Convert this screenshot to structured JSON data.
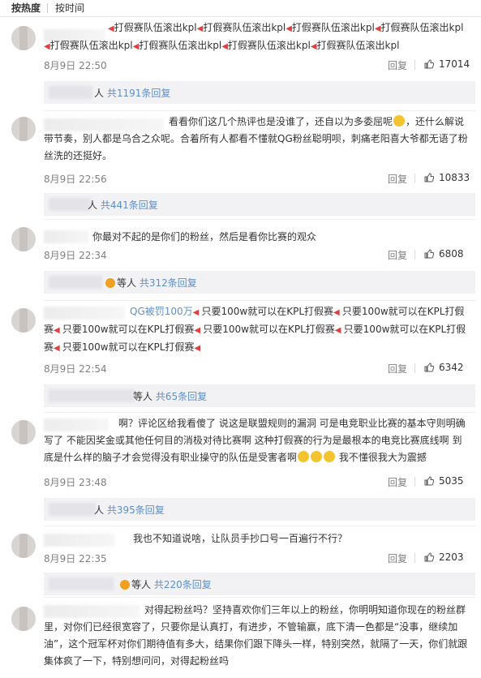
{
  "tabs": {
    "hot": "按热度",
    "time": "按时间"
  },
  "comments": [
    {
      "text_html": "<span class='speaker'>🔈</span>打假赛队伍滚出kpl<span class='speaker'>🔈</span>打假赛队伍滚出kpl<span class='speaker'>🔈</span>打假赛队伍滚出kpl<span class='speaker'>🔈</span>打假赛队伍滚出kpl<span class='speaker'>🔈</span>打假赛队伍滚出kpl<span class='speaker'>🔈</span>打假赛队伍滚出kpl<span class='speaker'>🔈</span>打假赛队伍滚出kpl<span class='speaker'>🔈</span>打假赛队伍滚出kpl",
      "date": "8月9日 22:50",
      "reply": "回复",
      "likes": "17014",
      "sub_prefix": "人 ",
      "sub_count": "共1191条回复"
    },
    {
      "text": "看看你们这几个热评也是没谁了，还自以为多委屈呢",
      "text2": "，还什么解说带节奏，别人都是乌合之众呢。合着所有人都看不懂就QG粉丝聪明呗，刺痛老阳喜大爷都无语了粉丝洗的还挺好。",
      "date": "8月9日 22:56",
      "reply": "回复",
      "likes": "10833",
      "sub_prefix": "人 ",
      "sub_count": "共441条回复"
    },
    {
      "text": "你最对不起的是你们的粉丝，然后是看你比赛的观众",
      "date": "8月9日 22:34",
      "reply": "回复",
      "likes": "6808",
      "sub_prefix": "等人 ",
      "sub_count": "共312条回复"
    },
    {
      "text_lead": "QG被罚100万",
      "text": "只要100w就可以在KPL打假赛",
      "text_tail": "只要100w就可以在KPL打假赛",
      "date": "8月9日 22:54",
      "reply": "回复",
      "likes": "6342",
      "sub_prefix": "等人 ",
      "sub_count": "共65条回复"
    },
    {
      "text": "啊？评论区给我看傻了 说这是联盟规则的漏洞 可是电竞职业比赛的基本守则明确写了 不能因奖金或其他任何目的消极对待比赛啊 这种打假赛的行为是最根本的电竞比赛底线啊 到底是什么样的脑子才会觉得没有职业操守的队伍是受害者啊",
      "text_tail": "我不懂很我大为震撼",
      "date": "8月9日 23:48",
      "reply": "回复",
      "likes": "5035",
      "sub_prefix": "人 ",
      "sub_count": "共395条回复"
    },
    {
      "text": "我也不知道说啥，让队员手抄口号一百遍行不行？",
      "date": "8月9日 22:35",
      "reply": "回复",
      "likes": "2203",
      "sub_prefix": "等人 ",
      "sub_count": "共220条回复"
    },
    {
      "text": "对得起粉丝吗？坚持喜欢你们三年以上的粉丝，你明明知道你现在的粉丝群里，对你们已经很宽容了，只要你是认真打，有进步，不管输赢，底下清一色都是“没事，继续加油”，这个冠军杯对你们期待值有多大，结果你们跟下降头一样，特别突然，就隔了一天，你们就跟集体疯了一下，特别想问问，对得起粉丝吗"
    }
  ]
}
